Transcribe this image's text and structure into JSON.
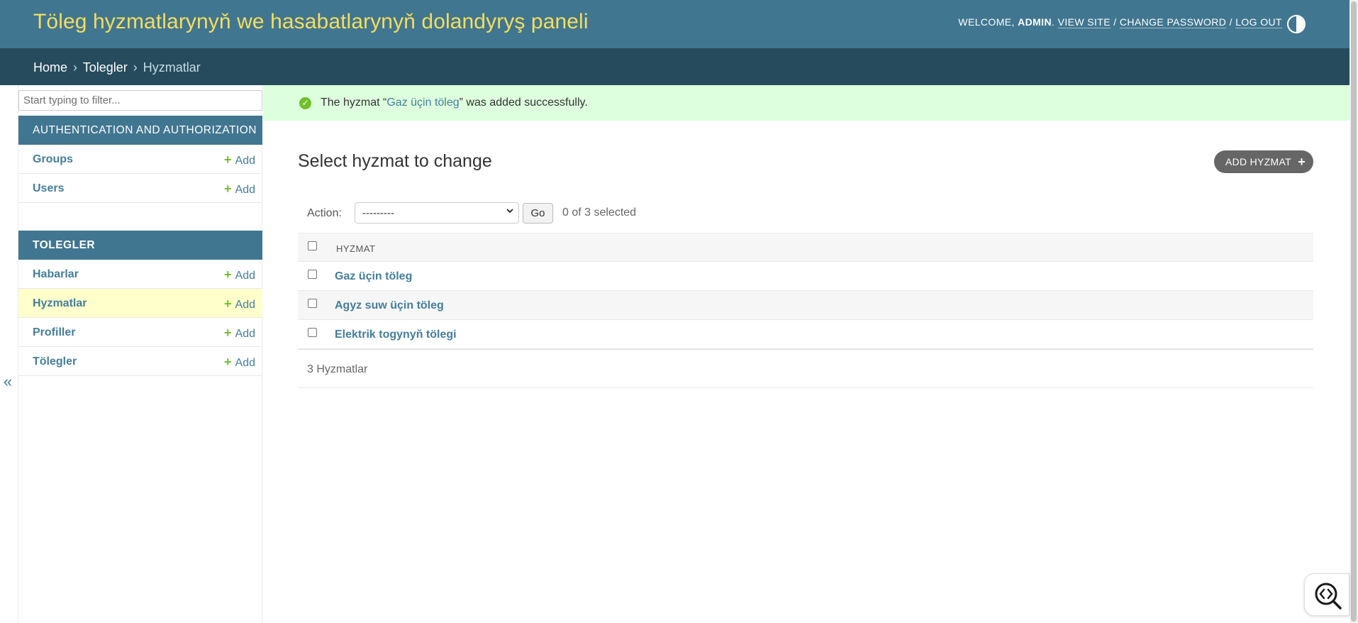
{
  "header": {
    "site_title": "Töleg hyzmatlarynyň we hasabatlarynyň dolandyryş paneli",
    "welcome": "Welcome,",
    "username": "admin",
    "view_site": "View site",
    "change_password": "Change password",
    "log_out": "Log out",
    "separator": "/"
  },
  "breadcrumbs": {
    "home": "Home",
    "app": "Tolegler",
    "current": "Hyzmatlar",
    "separator": "›"
  },
  "sidebar": {
    "filter_placeholder": "Start typing to filter...",
    "modules": [
      {
        "caption": "AUTHENTICATION AND AUTHORIZATION",
        "items": [
          {
            "label": "Groups",
            "add": "Add"
          },
          {
            "label": "Users",
            "add": "Add"
          }
        ]
      },
      {
        "caption": "TOLEGLER",
        "items": [
          {
            "label": "Habarlar",
            "add": "Add"
          },
          {
            "label": "Hyzmatlar",
            "add": "Add"
          },
          {
            "label": "Profiller",
            "add": "Add"
          },
          {
            "label": "Tölegler",
            "add": "Add"
          }
        ]
      }
    ],
    "collapse_toggle": "«"
  },
  "message": {
    "prefix": "The hyzmat “",
    "object_link": "Gaz üçin töleg",
    "suffix": "” was added successfully."
  },
  "content": {
    "title": "Select hyzmat to change",
    "add_button": "ADD HYZMAT",
    "action_label": "Action:",
    "action_selected": "---------",
    "go_button": "Go",
    "selection_counter": "0 of 3 selected",
    "column_header": "HYZMAT",
    "rows": [
      {
        "name": "Gaz üçin töleg"
      },
      {
        "name": "Agyz suw üçin töleg"
      },
      {
        "name": "Elektrik togynyň tölegi"
      }
    ],
    "result_count": "3 Hyzmatlar"
  },
  "colors": {
    "header_bg": "#417690",
    "branding": "#f5dd5d",
    "breadcrumbs_bg": "#264b5d",
    "link": "#447e9b",
    "success_bg": "#ddffdd",
    "add_green": "#70bf2b",
    "current_row": "#ffffcc"
  }
}
